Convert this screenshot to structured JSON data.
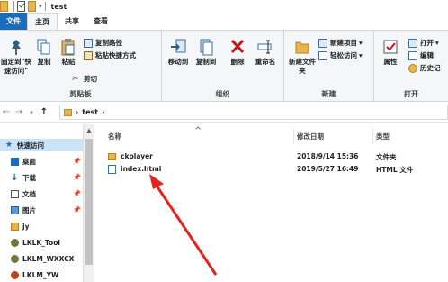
{
  "window": {
    "title": "test"
  },
  "tabs": [
    {
      "label": "文件"
    },
    {
      "label": "主页"
    },
    {
      "label": "共享"
    },
    {
      "label": "查看"
    }
  ],
  "ribbon": {
    "clipboard": {
      "group_label": "剪贴板",
      "pin_label": "固定到\"快速访问\"",
      "copy_label": "复制",
      "paste_label": "粘贴",
      "copy_path_label": "复制路径",
      "paste_shortcut_label": "粘贴快捷方式",
      "cut_label": "剪切"
    },
    "organize": {
      "group_label": "组织",
      "move_to_label": "移动到",
      "copy_to_label": "复制到",
      "delete_label": "删除",
      "rename_label": "重命名"
    },
    "new": {
      "group_label": "新建",
      "new_folder_label": "新建文件夹",
      "new_item_label": "新建项目",
      "easy_access_label": "轻松访问"
    },
    "open": {
      "group_label": "打开",
      "properties_label": "属性",
      "open_label": "打开",
      "edit_label": "编辑",
      "history_label": "历史记"
    }
  },
  "address": {
    "path": "test"
  },
  "nav": {
    "items": [
      {
        "label": "快速访问",
        "pinned": false
      },
      {
        "label": "桌面",
        "pinned": true
      },
      {
        "label": "下载",
        "pinned": true
      },
      {
        "label": "文档",
        "pinned": true
      },
      {
        "label": "图片",
        "pinned": true
      },
      {
        "label": "jy",
        "pinned": false
      },
      {
        "label": "LKLK_Tool",
        "pinned": false
      },
      {
        "label": "LKLM_WXXCX",
        "pinned": false
      },
      {
        "label": "LKLM_YW",
        "pinned": false
      }
    ]
  },
  "columns": {
    "name": "名称",
    "modified": "修改日期",
    "type": "类型"
  },
  "files": [
    {
      "name": "ckplayer",
      "modified": "2018/9/14 15:36",
      "type": "文件夹",
      "icon": "folder-icon"
    },
    {
      "name": "index.html",
      "modified": "2019/5/27 16:49",
      "type": "HTML 文件",
      "icon": "html-file-icon"
    }
  ],
  "colors": {
    "file_tab": "#1a6dbd",
    "annotation_arrow": "#e0261c",
    "folder": "#e8b54a"
  }
}
